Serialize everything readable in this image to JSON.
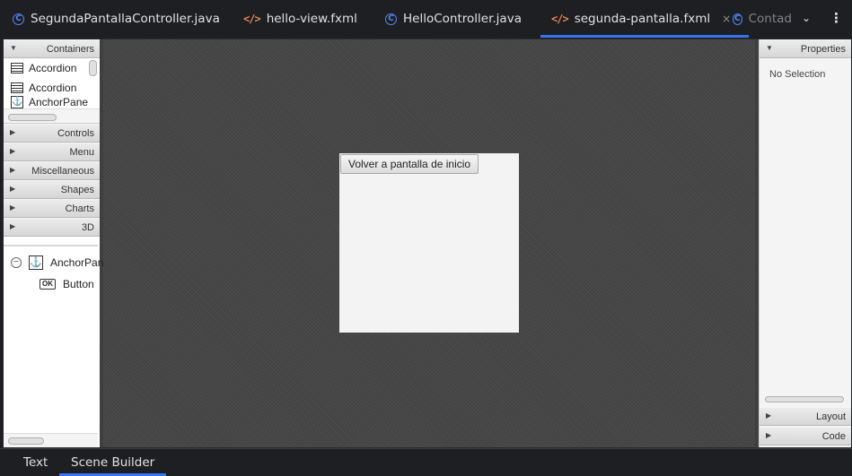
{
  "editor_tabs": [
    {
      "label": "SegundaPantallaController.java",
      "type": "java"
    },
    {
      "label": "hello-view.fxml",
      "type": "fxml"
    },
    {
      "label": "HelloController.java",
      "type": "java"
    },
    {
      "label": "segunda-pantalla.fxml",
      "type": "fxml",
      "active": true,
      "close": "×"
    },
    {
      "label": "Contad",
      "type": "java"
    }
  ],
  "tab_icons": {
    "java": "C",
    "fxml": "</>",
    "overflow": "⌄",
    "more": "⋮"
  },
  "library": {
    "sections": [
      "Containers",
      "Controls",
      "Menu",
      "Miscellaneous",
      "Shapes",
      "Charts",
      "3D"
    ],
    "container_items": [
      "Accordion",
      "Accordion",
      "AnchorPane"
    ]
  },
  "hierarchy": {
    "root": "AnchorPane",
    "child": "Button",
    "child_icon": "OK"
  },
  "canvas": {
    "button_text": "Volver a pantalla de inicio"
  },
  "inspector": {
    "properties": "Properties",
    "no_selection": "No Selection",
    "layout": "Layout",
    "code": "Code"
  },
  "bottom_tabs": [
    "Text",
    "Scene Builder"
  ],
  "colors": {
    "accent": "#3574f0",
    "java_icon": "#548af7",
    "fxml_icon": "#e08855"
  }
}
